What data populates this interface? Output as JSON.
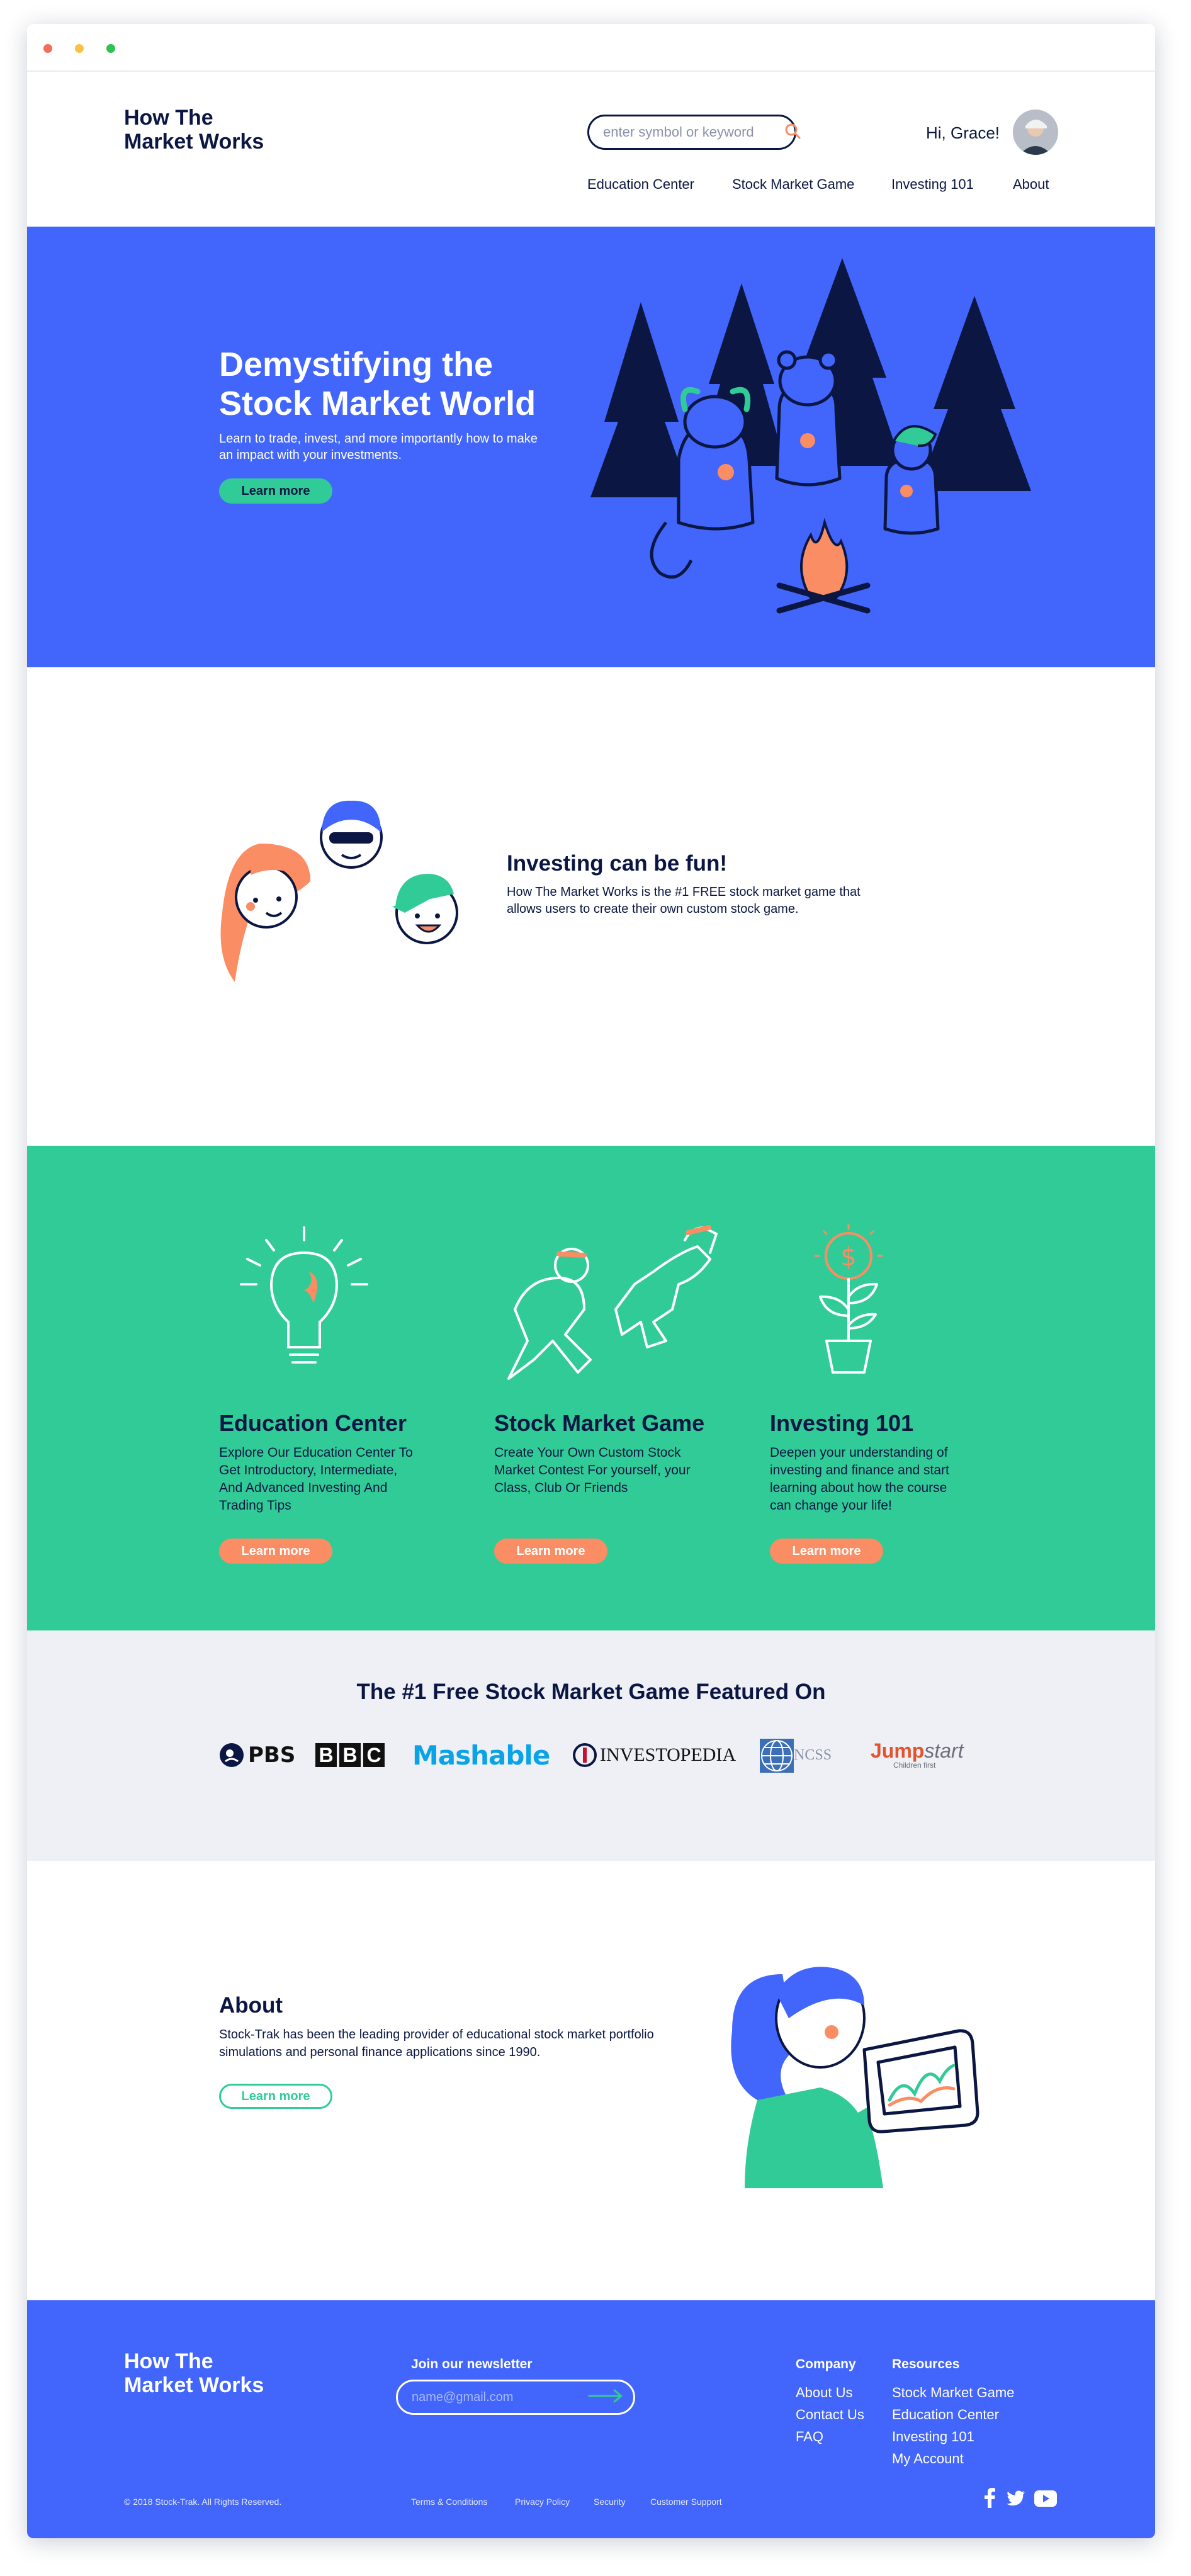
{
  "brand": {
    "logo_line1": "How The",
    "logo_line2": "Market Works"
  },
  "search": {
    "placeholder": "enter symbol or keyword"
  },
  "user": {
    "greeting": "Hi, Grace!"
  },
  "nav": [
    "Education Center",
    "Stock Market Game",
    "Investing 101",
    "About"
  ],
  "hero": {
    "title_line1": "Demystifying the",
    "title_line2": "Stock Market World",
    "subtitle": "Learn to trade, invest, and more importantly how to make an impact with your investments.",
    "cta": "Learn more"
  },
  "fun": {
    "title": "Investing can be fun!",
    "text": "How The Market Works is the #1 FREE stock market game that allows users to create their own custom stock game."
  },
  "features": [
    {
      "title": "Education Center",
      "text": "Explore Our Education Center To Get Introductory, Intermediate, And Advanced Investing And Trading Tips",
      "cta": "Learn more"
    },
    {
      "title": "Stock Market Game",
      "text": "Create Your Own Custom Stock Market Contest For yourself, your Class, Club Or Friends",
      "cta": "Learn more"
    },
    {
      "title": "Investing 101",
      "text": "Deepen your understanding of investing and finance and start learning about how the course can change your life!",
      "cta": "Learn more"
    }
  ],
  "featured": {
    "title": "The #1 Free Stock Market Game Featured On",
    "logos": {
      "pbs": "PBS",
      "bbc": [
        "B",
        "B",
        "C"
      ],
      "mashable": "Mashable",
      "investopedia": "INVESTOPEDIA",
      "ncss": "NCSS",
      "jump": "Jump",
      "start": "start",
      "children_first": "Children first"
    }
  },
  "about": {
    "title": "About",
    "text": "Stock-Trak has been the leading provider of educational stock market portfolio simulations and personal finance applications since 1990.",
    "cta": "Learn more"
  },
  "footer": {
    "logo_line1": "How The",
    "logo_line2": "Market Works",
    "newsletter_title": "Join our newsletter",
    "newsletter_placeholder": "name@gmail.com",
    "company_title": "Company",
    "company_links": [
      "About Us",
      "Contact Us",
      "FAQ"
    ],
    "resources_title": "Resources",
    "resources_links": [
      "Stock Market Game",
      "Education Center",
      "Investing 101",
      "My Account"
    ],
    "copyright": "© 2018 Stock-Trak. All Rights Reserved.",
    "legal_links": [
      "Terms & Conditions",
      "Privacy Policy",
      "Security",
      "Customer Support"
    ]
  },
  "colors": {
    "primary_blue": "#4265fb",
    "green": "#31cb97",
    "orange": "#fa8d63",
    "navy": "#0b1742",
    "light_gray": "#eef0f5"
  },
  "icons": [
    "search-icon",
    "arrow-right-icon",
    "facebook-icon",
    "twitter-icon",
    "youtube-icon"
  ]
}
